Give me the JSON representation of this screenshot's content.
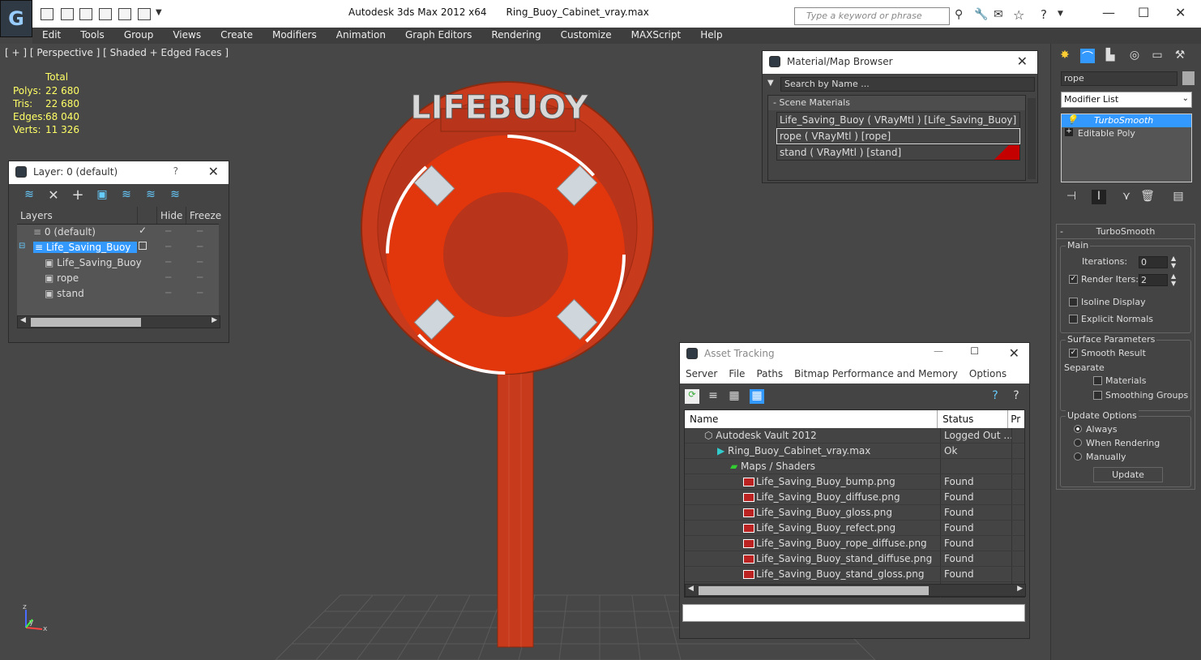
{
  "title_bar": {
    "app": "Autodesk 3ds Max  2012 x64",
    "file": "Ring_Buoy_Cabinet_vray.max",
    "search_placeholder": "Type a keyword or phrase"
  },
  "menu": [
    "Edit",
    "Tools",
    "Group",
    "Views",
    "Create",
    "Modifiers",
    "Animation",
    "Graph Editors",
    "Rendering",
    "Customize",
    "MAXScript",
    "Help"
  ],
  "viewport": {
    "label": "[ + ] [ Perspective ] [ Shaded + Edged Faces ]",
    "stats_header": "Total",
    "stats": [
      {
        "k": "Polys:",
        "v": "22 680"
      },
      {
        "k": "Tris:",
        "v": "22 680"
      },
      {
        "k": "Edges:",
        "v": "68 040"
      },
      {
        "k": "Verts:",
        "v": "11 326"
      }
    ],
    "sign_text": "LIFEBUOY",
    "axis": {
      "z": "z",
      "x": "x",
      "y": "y"
    }
  },
  "layer_panel": {
    "title": "Layer: 0 (default)",
    "help": "?",
    "cols": [
      "Layers",
      "Hide",
      "Freeze"
    ],
    "rows": [
      {
        "name": "0 (default)",
        "indent": 1,
        "selected": false,
        "current": true
      },
      {
        "name": "Life_Saving_Buoy",
        "indent": 1,
        "selected": true,
        "current": false
      },
      {
        "name": "Life_Saving_Buoy",
        "indent": 2,
        "selected": false,
        "current": false
      },
      {
        "name": "rope",
        "indent": 2,
        "selected": false,
        "current": false
      },
      {
        "name": "stand",
        "indent": 2,
        "selected": false,
        "current": false
      }
    ]
  },
  "material_browser": {
    "title": "Material/Map Browser",
    "search": "Search by Name ...",
    "section": "Scene Materials",
    "items": [
      "Life_Saving_Buoy  ( VRayMtl )  [Life_Saving_Buoy]",
      "rope  ( VRayMtl )  [rope]",
      "stand  ( VRayMtl )  [stand]"
    ]
  },
  "asset_tracking": {
    "title": "Asset Tracking",
    "menu": [
      "Server",
      "File",
      "Paths",
      "Bitmap Performance and Memory",
      "Options"
    ],
    "cols": [
      "Name",
      "Status",
      "Pr"
    ],
    "rows": [
      {
        "name": "Autodesk Vault 2012",
        "status": "Logged Out ...",
        "indent": 0,
        "icon": "vault"
      },
      {
        "name": "Ring_Buoy_Cabinet_vray.max",
        "status": "Ok",
        "indent": 1,
        "icon": "max"
      },
      {
        "name": "Maps / Shaders",
        "status": "",
        "indent": 2,
        "icon": "maps"
      },
      {
        "name": "Life_Saving_Buoy_bump.png",
        "status": "Found",
        "indent": 3,
        "icon": "png"
      },
      {
        "name": "Life_Saving_Buoy_diffuse.png",
        "status": "Found",
        "indent": 3,
        "icon": "png"
      },
      {
        "name": "Life_Saving_Buoy_gloss.png",
        "status": "Found",
        "indent": 3,
        "icon": "png"
      },
      {
        "name": "Life_Saving_Buoy_refect.png",
        "status": "Found",
        "indent": 3,
        "icon": "png"
      },
      {
        "name": "Life_Saving_Buoy_rope_diffuse.png",
        "status": "Found",
        "indent": 3,
        "icon": "png"
      },
      {
        "name": "Life_Saving_Buoy_stand_diffuse.png",
        "status": "Found",
        "indent": 3,
        "icon": "png"
      },
      {
        "name": "Life_Saving_Buoy_stand_gloss.png",
        "status": "Found",
        "indent": 3,
        "icon": "png"
      }
    ]
  },
  "command_panel": {
    "object_name": "rope",
    "modifier_list": "Modifier List",
    "stack": [
      "TurboSmooth",
      "Editable Poly"
    ],
    "rollout": "TurboSmooth",
    "main": "Main",
    "iterations_label": "Iterations:",
    "iterations": "0",
    "render_iters_label": "Render Iters:",
    "render_iters": "2",
    "isoline": "Isoline Display",
    "explicit": "Explicit Normals",
    "surface": "Surface Parameters",
    "smooth": "Smooth Result",
    "separate": "Separate",
    "materials": "Materials",
    "smoothing": "Smoothing Groups",
    "update_opts": "Update Options",
    "always": "Always",
    "when_rendering": "When Rendering",
    "manually": "Manually",
    "update_btn": "Update"
  },
  "colors": {
    "buoy": "#e2360c",
    "stand": "#c83a1c",
    "accent": "#3399ff"
  }
}
